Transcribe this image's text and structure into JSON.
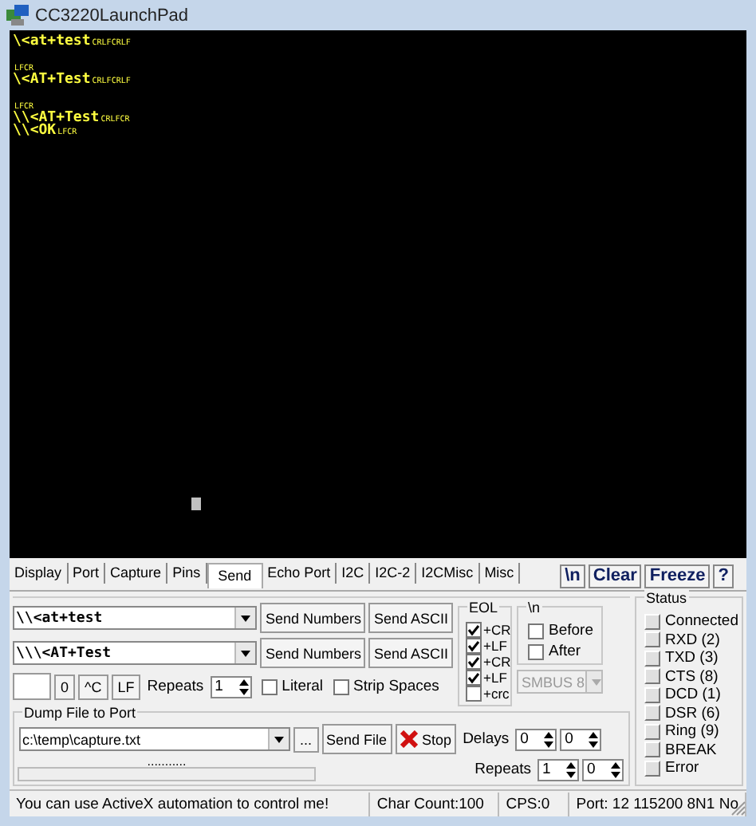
{
  "window": {
    "title": "CC3220LaunchPad"
  },
  "terminal": {
    "lines": [
      {
        "kind": "line",
        "segments": [
          {
            "kind": "text",
            "t": "\\<at+test"
          },
          {
            "kind": "ctrl",
            "t": "CRLFCRLF"
          }
        ]
      },
      {
        "kind": "blank"
      },
      {
        "kind": "line",
        "segments": [
          {
            "kind": "ctrl",
            "t": "LFCR"
          }
        ]
      },
      {
        "kind": "line",
        "segments": [
          {
            "kind": "text",
            "t": "\\<AT+Test"
          },
          {
            "kind": "ctrl",
            "t": "CRLFCRLF"
          }
        ]
      },
      {
        "kind": "blank"
      },
      {
        "kind": "line",
        "segments": [
          {
            "kind": "ctrl",
            "t": "LFCR"
          }
        ]
      },
      {
        "kind": "line",
        "segments": [
          {
            "kind": "text",
            "t": "\\\\<AT+Test"
          },
          {
            "kind": "ctrl",
            "t": "CRLFCR"
          }
        ]
      },
      {
        "kind": "line",
        "segments": [
          {
            "kind": "text",
            "t": "\\\\<OK"
          },
          {
            "kind": "ctrl",
            "t": "LFCR"
          }
        ]
      }
    ]
  },
  "tabs": [
    {
      "label": "Display",
      "selected": false
    },
    {
      "label": "Port",
      "selected": false
    },
    {
      "label": "Capture",
      "selected": false
    },
    {
      "label": "Pins",
      "selected": false
    },
    {
      "label": "Send",
      "selected": true
    },
    {
      "label": "Echo Port",
      "selected": false
    },
    {
      "label": "I2C",
      "selected": false
    },
    {
      "label": "I2C-2",
      "selected": false
    },
    {
      "label": "I2CMisc",
      "selected": false
    },
    {
      "label": "Misc",
      "selected": false
    }
  ],
  "toolbar_buttons": [
    "\\n",
    "Clear",
    "Freeze",
    "?"
  ],
  "send_rows": [
    {
      "value": "\\\\<at+test",
      "buttons": [
        "Send Numbers",
        "Send ASCII"
      ]
    },
    {
      "value": "\\\\\\<AT+Test",
      "buttons": [
        "Send Numbers",
        "Send ASCII"
      ]
    }
  ],
  "row3": {
    "buttons": [
      "0",
      "^C",
      "LF"
    ],
    "repeats_label": "Repeats",
    "repeats": "1",
    "checkboxes": [
      {
        "label": "Literal",
        "checked": false
      },
      {
        "label": "Strip Spaces",
        "checked": false
      }
    ]
  },
  "eol": {
    "title": "EOL",
    "items": [
      {
        "label": "+CR",
        "checked": true
      },
      {
        "label": "+LF",
        "checked": true
      },
      {
        "label": "+CR",
        "checked": true
      },
      {
        "label": "+LF",
        "checked": true
      },
      {
        "label": "+crc",
        "checked": false
      }
    ]
  },
  "newline_group": {
    "title": "\\n",
    "items": [
      {
        "label": "Before",
        "checked": false
      },
      {
        "label": "After",
        "checked": false
      }
    ]
  },
  "smbus": {
    "value": "SMBUS 8",
    "disabled": true
  },
  "dump": {
    "title": "Dump File to Port",
    "path": "c:\\temp\\capture.txt",
    "browse": "...",
    "send_file": "Send File",
    "stop": "Stop",
    "delays_label": "Delays",
    "delays": [
      "0",
      "0"
    ],
    "progress_text": "...........",
    "progress": {
      "level": 0
    },
    "repeats_label": "Repeats",
    "repeats": [
      "1",
      "0"
    ]
  },
  "status": {
    "title": "Status",
    "items": [
      {
        "label": "Connected",
        "on": false
      },
      {
        "label": "RXD (2)",
        "on": false
      },
      {
        "label": "TXD (3)",
        "on": false
      },
      {
        "label": "CTS (8)",
        "on": false
      },
      {
        "label": "DCD (1)",
        "on": false
      },
      {
        "label": "DSR (6)",
        "on": false
      },
      {
        "label": "Ring (9)",
        "on": false
      },
      {
        "label": "BREAK",
        "on": false
      },
      {
        "label": "Error",
        "on": false
      }
    ]
  },
  "status_bar": [
    "You can use ActiveX automation to control me!",
    "Char Count:100",
    "CPS:0",
    "Port: 12 115200 8N1 No"
  ]
}
